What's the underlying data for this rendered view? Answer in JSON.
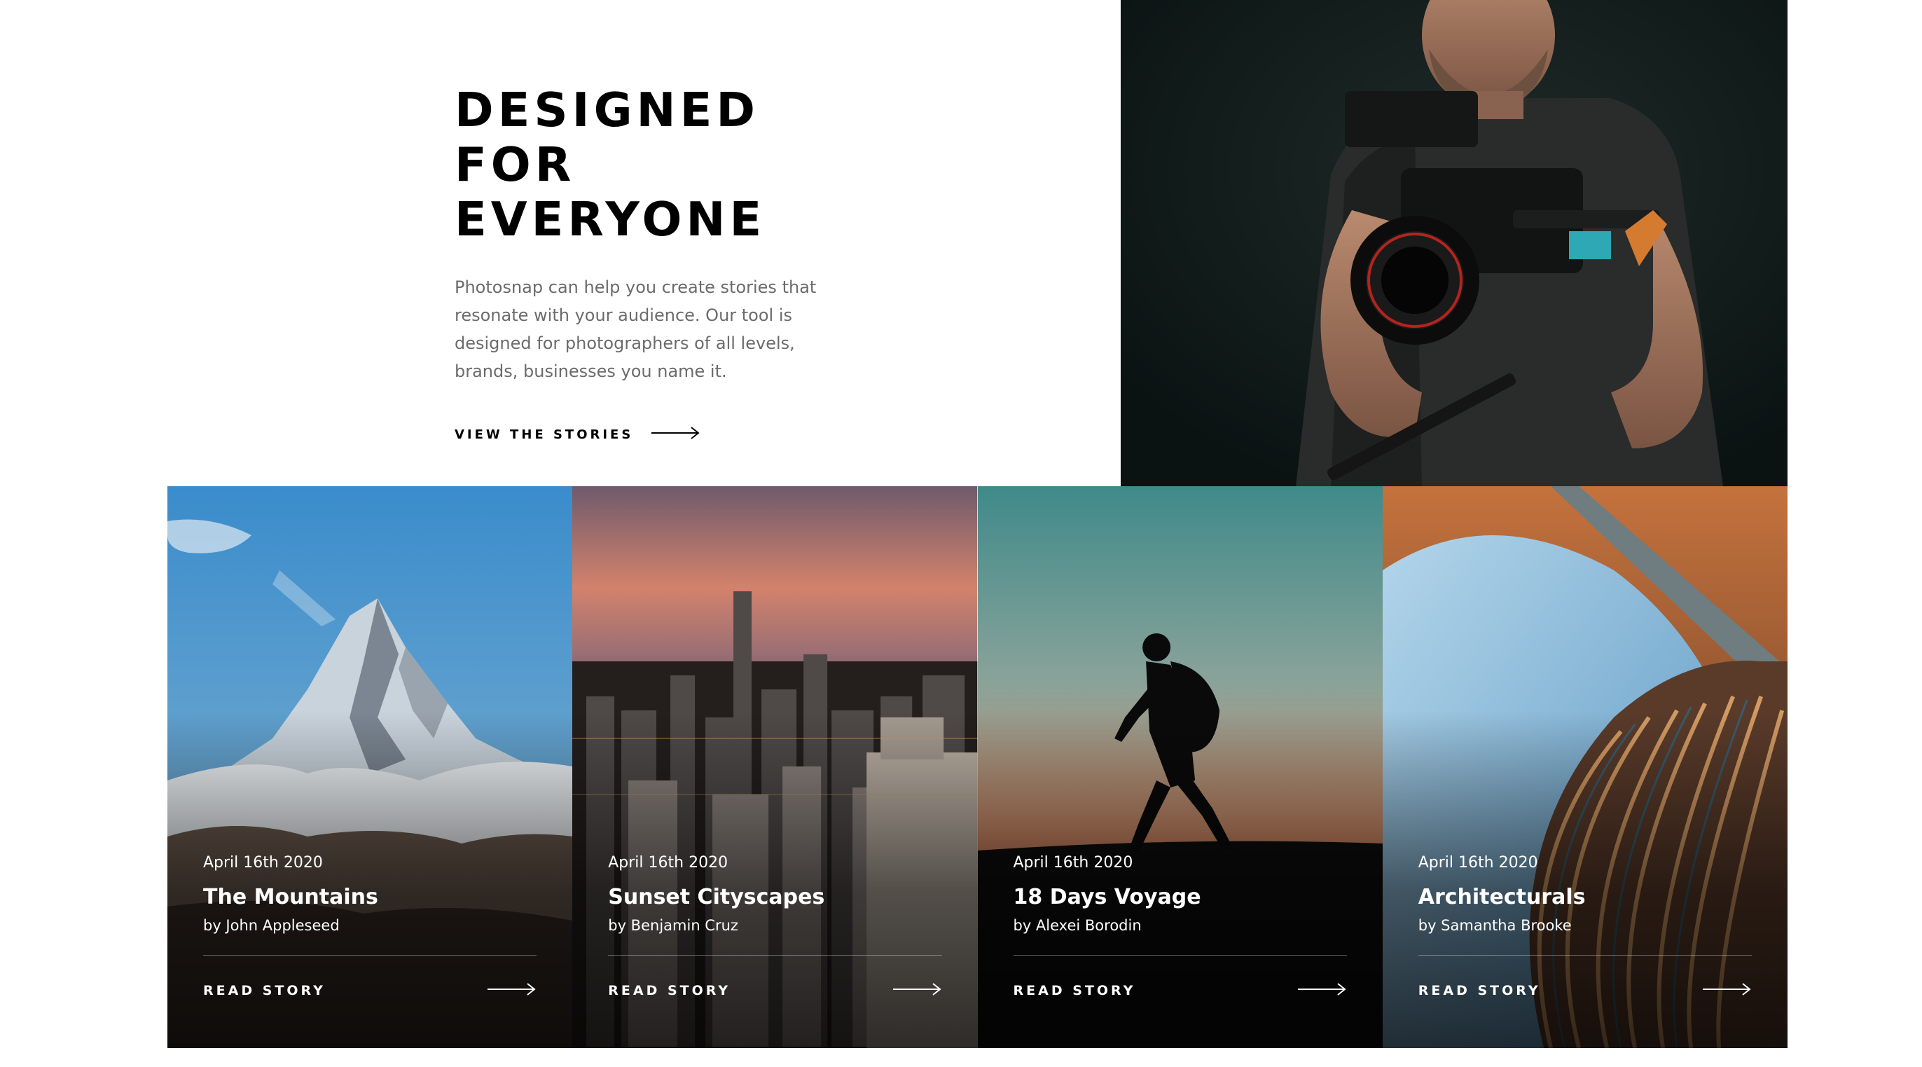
{
  "intro": {
    "title_line1": "DESIGNED FOR",
    "title_line2": "EVERYONE",
    "description": "Photosnap can help you create stories that resonate with your audience. Our tool is designed for photographers of all levels, brands, businesses you name it.",
    "link_label": "VIEW THE STORIES",
    "link_icon": "arrow-right-icon",
    "photo_icon": "videographer-photo"
  },
  "stories": [
    {
      "date": "April 16th 2020",
      "title": "The Mountains",
      "author": "by John Appleseed",
      "cta": "READ STORY",
      "icon": "arrow-right-icon"
    },
    {
      "date": "April 16th 2020",
      "title": "Sunset Cityscapes",
      "author": "by Benjamin Cruz",
      "cta": "READ STORY",
      "icon": "arrow-right-icon"
    },
    {
      "date": "April 16th 2020",
      "title": "18 Days Voyage",
      "author": "by Alexei Borodin",
      "cta": "READ STORY",
      "icon": "arrow-right-icon"
    },
    {
      "date": "April 16th 2020",
      "title": "Architecturals",
      "author": "by Samantha Brooke",
      "cta": "READ STORY",
      "icon": "arrow-right-icon"
    }
  ],
  "colors": {
    "heading": "#000000",
    "body_text": "#6b6b6b",
    "card_text": "#ffffff"
  }
}
